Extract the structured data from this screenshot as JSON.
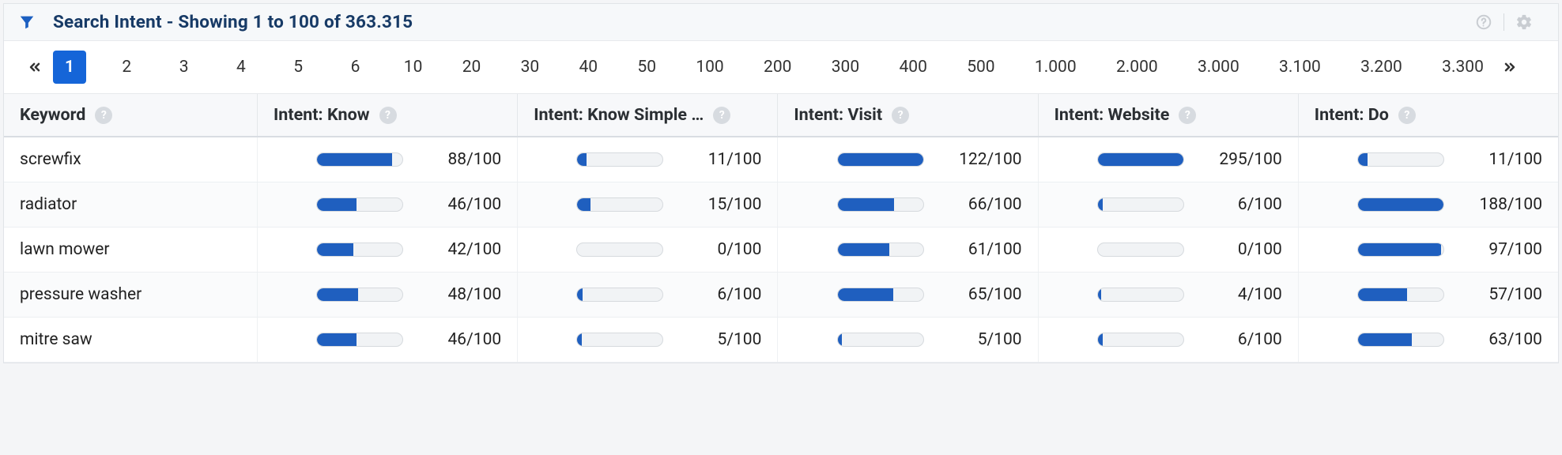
{
  "header": {
    "title": "Search Intent - Showing 1 to 100 of 363.315"
  },
  "pagination": {
    "pages": [
      "1",
      "2",
      "3",
      "4",
      "5",
      "6",
      "10",
      "20",
      "30",
      "40",
      "50",
      "100",
      "200",
      "300",
      "400",
      "500",
      "1.000",
      "2.000",
      "3.000",
      "3.100",
      "3.200",
      "3.300"
    ],
    "active": "1"
  },
  "columns": [
    {
      "key": "keyword",
      "label": "Keyword"
    },
    {
      "key": "know",
      "label": "Intent: Know"
    },
    {
      "key": "know_simple",
      "label": "Intent: Know Simple …"
    },
    {
      "key": "visit",
      "label": "Intent: Visit"
    },
    {
      "key": "website",
      "label": "Intent: Website"
    },
    {
      "key": "do",
      "label": "Intent: Do"
    }
  ],
  "rows": [
    {
      "keyword": "screwfix",
      "know": 88,
      "know_simple": 11,
      "visit": 122,
      "website": 295,
      "do": 11
    },
    {
      "keyword": "radiator",
      "know": 46,
      "know_simple": 15,
      "visit": 66,
      "website": 6,
      "do": 188
    },
    {
      "keyword": "lawn mower",
      "know": 42,
      "know_simple": 0,
      "visit": 61,
      "website": 0,
      "do": 97
    },
    {
      "keyword": "pressure washer",
      "know": 48,
      "know_simple": 6,
      "visit": 65,
      "website": 4,
      "do": 57
    },
    {
      "keyword": "mitre saw",
      "know": 46,
      "know_simple": 5,
      "visit": 5,
      "website": 6,
      "do": 63
    }
  ],
  "scale_max": 100,
  "value_suffix": "/100"
}
